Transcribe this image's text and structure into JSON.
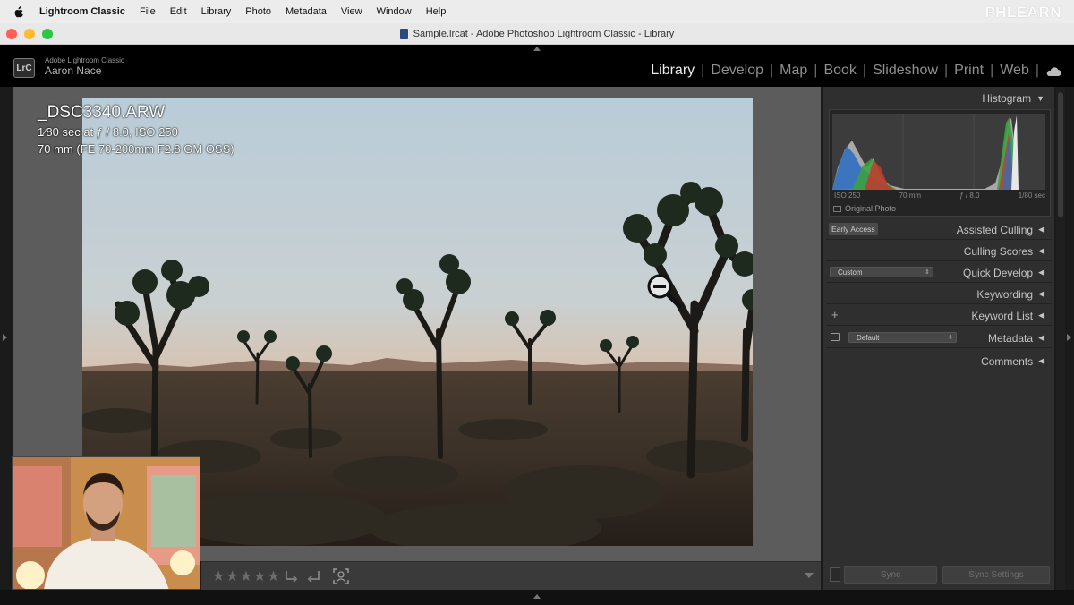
{
  "menubar": {
    "app_name": "Lightroom Classic",
    "items": [
      "File",
      "Edit",
      "Library",
      "Photo",
      "Metadata",
      "View",
      "Window",
      "Help"
    ],
    "brand": "PHLEARN"
  },
  "window": {
    "title": "Sample.lrcat - Adobe Photoshop Lightroom Classic - Library"
  },
  "identity": {
    "badge": "LrC",
    "app_name": "Adobe Lightroom Classic",
    "user": "Aaron Nace"
  },
  "modules": [
    "Library",
    "Develop",
    "Map",
    "Book",
    "Slideshow",
    "Print",
    "Web"
  ],
  "active_module": "Library",
  "photo_info": {
    "filename": "_DSC3340.ARW",
    "exposure": "1⁄80 sec at ƒ / 8.0, ISO 250",
    "lens": "70 mm (FE 70-200mm F2.8 GM OSS)"
  },
  "toolbar": {
    "stars": "★★★★★"
  },
  "right_panel": {
    "histogram": {
      "title": "Histogram",
      "iso": "ISO 250",
      "focal": "70 mm",
      "aperture": "ƒ / 8.0",
      "shutter": "1/80 sec",
      "original_photo": "Original Photo"
    },
    "early_access": "Early Access",
    "sections": {
      "assisted_culling": "Assisted Culling",
      "culling_scores": "Culling Scores",
      "quick_develop": "Quick Develop",
      "keywording": "Keywording",
      "keyword_list": "Keyword List",
      "metadata": "Metadata",
      "comments": "Comments"
    },
    "quick_develop_preset": "Custom",
    "metadata_preset": "Default",
    "plus": "+",
    "sync": "Sync",
    "sync_settings": "Sync Settings"
  },
  "colors": {
    "accent_active": "#ededed",
    "panel_bg": "#2f2f2f",
    "stage_bg": "#5c5c5c"
  }
}
